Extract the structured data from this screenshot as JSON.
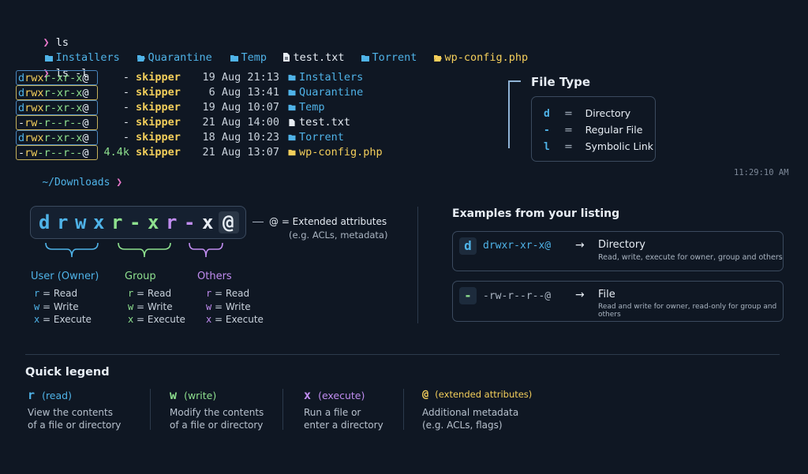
{
  "terminal": {
    "prompt_symbol": "❯",
    "cmd1": "ls",
    "cmd2": "ls -l",
    "ls_items": [
      {
        "name": "Installers",
        "icon": "folder-icon",
        "color": "#4fb3e8"
      },
      {
        "name": "Quarantine",
        "icon": "folder-open-icon",
        "color": "#4fb3e8"
      },
      {
        "name": "Temp",
        "icon": "folder-icon",
        "color": "#4fb3e8"
      },
      {
        "name": "test.txt",
        "icon": "file-icon",
        "color": "#e7edf4"
      },
      {
        "name": "Torrent",
        "icon": "folder-icon",
        "color": "#4fb3e8"
      },
      {
        "name": "wp-config.php",
        "icon": "php-file-icon",
        "color": "#f4cf5b"
      }
    ],
    "listing": [
      {
        "perm": "drwxr-xr-x@",
        "size": "-",
        "user": "skipper",
        "date": "19 Aug 21:13",
        "name": "Installers",
        "kind": "dir"
      },
      {
        "perm": "drwxr-xr-x@",
        "size": "-",
        "user": "skipper",
        "date": "6 Aug 13:41",
        "name": "Quarantine",
        "kind": "dir"
      },
      {
        "perm": "drwxr-xr-x@",
        "size": "-",
        "user": "skipper",
        "date": "19 Aug 10:07",
        "name": "Temp",
        "kind": "dir"
      },
      {
        "perm": "-rw-r--r--@",
        "size": "-",
        "user": "skipper",
        "date": "21 Aug 14:00",
        "name": "test.txt",
        "kind": "file"
      },
      {
        "perm": "drwxr-xr-x@",
        "size": "-",
        "user": "skipper",
        "date": "18 Aug 10:23",
        "name": "Torrent",
        "kind": "dir"
      },
      {
        "perm": "-rw-r--r--@",
        "size": "4.4k",
        "user": "skipper",
        "date": "21 Aug 13:07",
        "name": "wp-config.php",
        "kind": "php"
      }
    ],
    "cwd": "~/Downloads",
    "time": "11:29:10 AM"
  },
  "file_type": {
    "title": "File Type",
    "entries": [
      {
        "key": "d",
        "eq": "=",
        "label": "Directory"
      },
      {
        "key": "-",
        "eq": "=",
        "label": "Regular File"
      },
      {
        "key": "l",
        "eq": "=",
        "label": "Symbolic Link"
      }
    ]
  },
  "breakdown": {
    "chars": [
      "d",
      "r",
      "w",
      "x",
      "r",
      "-",
      "x",
      "r",
      "-",
      "x",
      "@"
    ],
    "at_note": "@ = Extended attributes",
    "at_note2": "(e.g. ACLs, metadata)",
    "groups": [
      {
        "title": "User (Owner)",
        "lines": [
          {
            "k": "r",
            "v": "= Read"
          },
          {
            "k": "w",
            "v": "= Write"
          },
          {
            "k": "x",
            "v": "= Execute"
          }
        ]
      },
      {
        "title": "Group",
        "lines": [
          {
            "k": "r",
            "v": "= Read"
          },
          {
            "k": "w",
            "v": "= Write"
          },
          {
            "k": "x",
            "v": "= Execute"
          }
        ]
      },
      {
        "title": "Others",
        "lines": [
          {
            "k": "r",
            "v": "= Read"
          },
          {
            "k": "w",
            "v": "= Write"
          },
          {
            "k": "x",
            "v": "= Execute"
          }
        ]
      }
    ]
  },
  "examples": {
    "title": "Examples from your listing",
    "items": [
      {
        "badge": "d",
        "perm": "drwxr-xr-x@",
        "arrow": "→",
        "type": "Directory",
        "desc": "Read, write, execute for owner, group and others"
      },
      {
        "badge": "-",
        "perm": "-rw-r--r--@",
        "arrow": "→",
        "type": "File",
        "desc": "Read and write for owner, read-only for group and others"
      }
    ]
  },
  "quick_legend": {
    "title": "Quick legend",
    "items": [
      {
        "key": "r",
        "label": "(read)",
        "line1": "View the contents",
        "line2": "of a file or directory"
      },
      {
        "key": "w",
        "label": "(write)",
        "line1": "Modify the contents",
        "line2": "of a file or directory"
      },
      {
        "key": "x",
        "label": "(execute)",
        "line1": "Run a file or",
        "line2": "enter a directory"
      },
      {
        "key": "@",
        "label": "(extended attributes)",
        "line1": "Additional metadata",
        "line2": "(e.g. ACLs, flags)"
      }
    ]
  },
  "colors": {
    "background": "#0f1723",
    "user": "#4fb3e8",
    "group": "#8ee08e",
    "others": "#c08cf0",
    "special": "#f4cf5b",
    "prompt": "#e777c9"
  }
}
